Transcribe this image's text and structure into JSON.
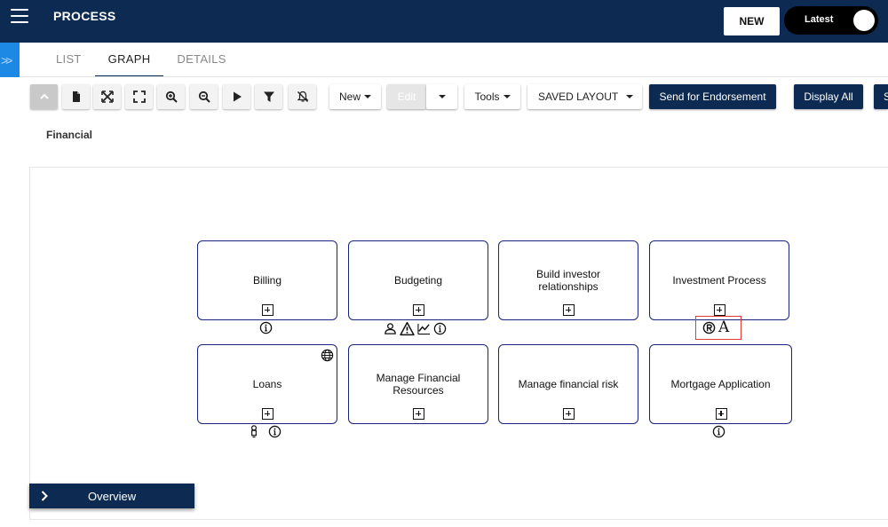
{
  "header": {
    "title": "PROCESS",
    "new_label": "NEW",
    "toggle_label": "Latest",
    "menu_icon": "hamburger-menu-icon"
  },
  "side_expander": {
    "icon": "double-chevron-right-icon",
    "glyph": ">>"
  },
  "tabs": [
    {
      "label": "LIST",
      "active": false
    },
    {
      "label": "GRAPH",
      "active": true
    },
    {
      "label": "DETAILS",
      "active": false
    }
  ],
  "toolbar": {
    "icons": [
      "collapse-up-icon",
      "document-icon",
      "fit-to-screen-icon",
      "fullscreen-icon",
      "zoom-in-icon",
      "zoom-out-icon",
      "play-icon",
      "filter-icon",
      "notifications-off-icon"
    ],
    "new_label": "New",
    "edit_label": "Edit",
    "tools_label": "Tools",
    "layout_label": "SAVED LAYOUT",
    "endorse_label": "Send for Endorsement",
    "display_all_label": "Display All",
    "cut_label": "S"
  },
  "breadcrumb": "Financial",
  "nodes": [
    {
      "label": "Billing",
      "badges": [
        "info-icon"
      ]
    },
    {
      "label": "Budgeting",
      "badges": [
        "person-icon",
        "warning-icon",
        "trend-chart-icon",
        "info-icon"
      ]
    },
    {
      "label": "Build investor relationships",
      "badges": []
    },
    {
      "label": "Investment Process",
      "badges": [
        "registered-icon",
        "letter-a-icon"
      ],
      "badge_text": "A",
      "badge_highlighted": true
    },
    {
      "label": "Loans",
      "badges": [
        "bulb-icon",
        "info-icon"
      ],
      "corner_icon": "globe-icon"
    },
    {
      "label": "Manage Financial Resources",
      "badges": []
    },
    {
      "label": "Manage financial risk",
      "badges": []
    },
    {
      "label": "Mortgage Application",
      "badges": [
        "info-icon"
      ]
    }
  ],
  "overview": {
    "label": "Overview",
    "icon": "chevron-right-icon"
  },
  "colors": {
    "header_bg": "#0d2b52",
    "accent_blue": "#1e88e5",
    "node_border": "#1a237e",
    "highlight": "#e53935"
  }
}
